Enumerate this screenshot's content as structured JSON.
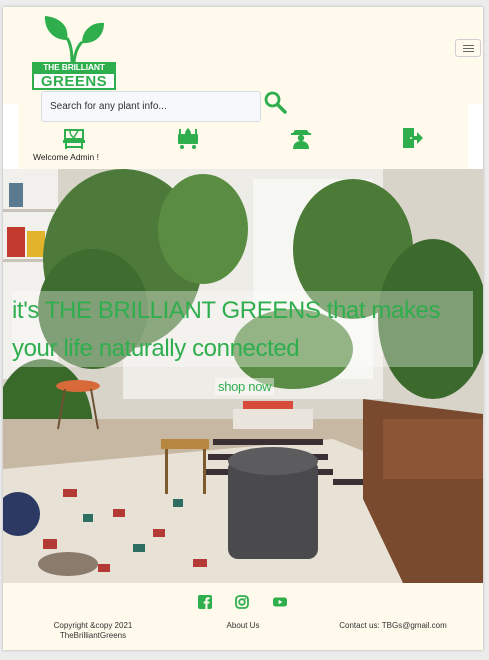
{
  "brand": {
    "line1": "THE BRILLIANT",
    "line2": "GREENS"
  },
  "search": {
    "placeholder": "Search for any plant info...",
    "value": ""
  },
  "nav": {
    "icons": [
      "garden-bench-icon",
      "plant-cart-icon",
      "gardener-icon",
      "logout-icon"
    ]
  },
  "welcome": "Welcome Admin !",
  "hero": {
    "tagline": "it's THE BRILLIANT GREENS that makes your life naturally connected",
    "cta": "shop now"
  },
  "footer": {
    "social": [
      "facebook-icon",
      "instagram-icon",
      "youtube-icon"
    ],
    "copyright_line1": "Copyright &copy 2021",
    "copyright_line2": "TheBrilliantGreens",
    "about": "About Us",
    "contact": "Contact us: TBGs@gmail.com"
  },
  "colors": {
    "accent": "#2fae4e",
    "cream": "#fffaeb"
  }
}
